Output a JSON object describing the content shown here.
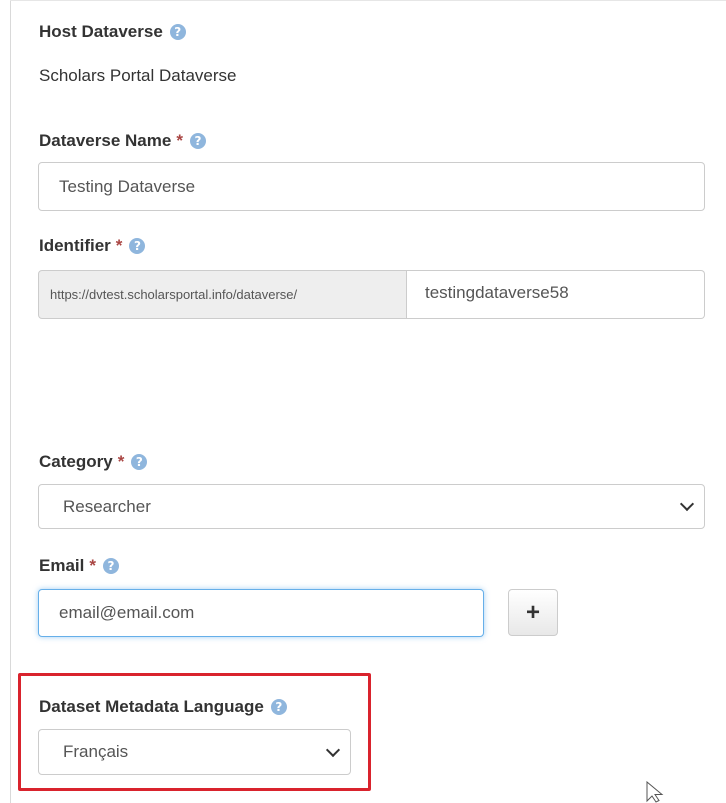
{
  "host_dataverse": {
    "label": "Host Dataverse",
    "value": "Scholars Portal Dataverse"
  },
  "dataverse_name": {
    "label": "Dataverse Name",
    "required_mark": "*",
    "value": "Testing Dataverse"
  },
  "identifier": {
    "label": "Identifier",
    "required_mark": "*",
    "url_prefix": "https://dvtest.scholarsportal.info/dataverse/",
    "value": "testingdataverse58"
  },
  "category": {
    "label": "Category",
    "required_mark": "*",
    "selected": "Researcher"
  },
  "email": {
    "label": "Email",
    "required_mark": "*",
    "value": "email@email.com",
    "add_label": "+"
  },
  "metadata_language": {
    "label": "Dataset Metadata Language",
    "selected": "Français"
  },
  "help_glyph": "?",
  "icons": {
    "help": "question-circle-icon",
    "add": "plus-icon",
    "dropdown": "chevron-down-icon",
    "cursor": "mouse-pointer-icon"
  },
  "colors": {
    "required": "#a94442",
    "help_icon": "#8fb6dd",
    "focus_border": "#66afe9",
    "highlight": "#d9232d"
  }
}
